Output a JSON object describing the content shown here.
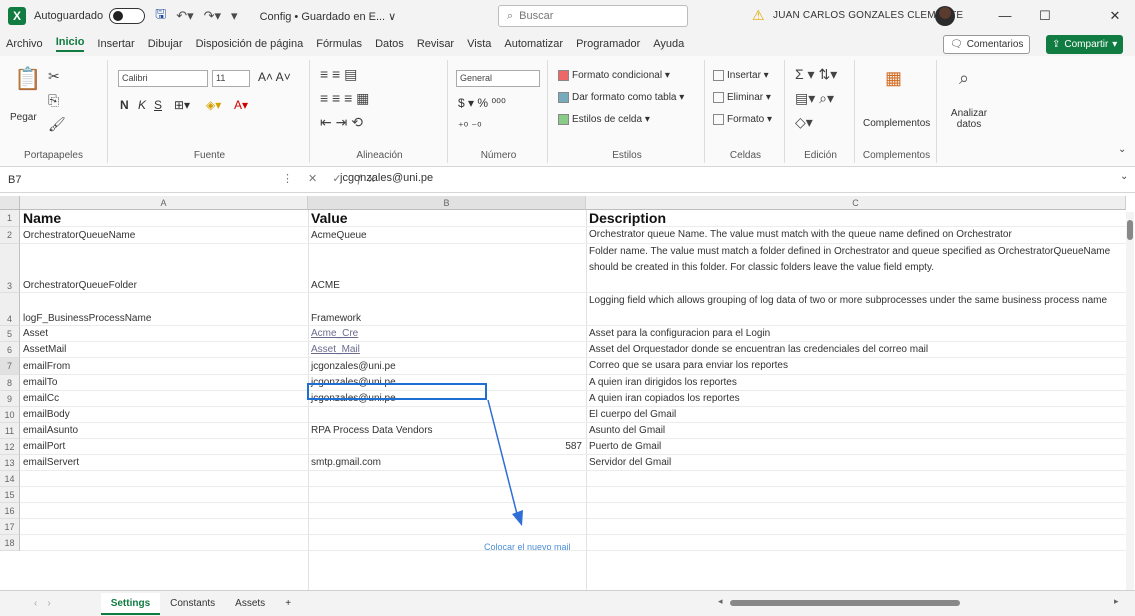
{
  "titlebar": {
    "autosave_label": "Autoguardado",
    "autosave_state": "●",
    "doc_title": "Config • Guardado en E... ∨",
    "search_placeholder": "Buscar",
    "user_name": "JUAN CARLOS GONZALES CLEMENTE"
  },
  "menu": {
    "items": [
      "Archivo",
      "Inicio",
      "Insertar",
      "Dibujar",
      "Disposición de página",
      "Fórmulas",
      "Datos",
      "Revisar",
      "Vista",
      "Automatizar",
      "Programador",
      "Ayuda"
    ],
    "comments_label": "Comentarios",
    "share_label": "Compartir"
  },
  "ribbon": {
    "paste_label": "Pegar",
    "clipboard_label": "Portapapeles",
    "font_name": "Calibri",
    "font_size": "11",
    "font_label": "Fuente",
    "alignment_label": "Alineación",
    "number_format": "General",
    "number_label": "Número",
    "cond_format": "Formato condicional",
    "format_table": "Dar formato como tabla",
    "cell_styles": "Estilos de celda",
    "styles_label": "Estilos",
    "insert": "Insertar",
    "delete": "Eliminar",
    "format": "Formato",
    "cells_label": "Celdas",
    "edit_label": "Edición",
    "complements": "Complementos",
    "complements_label": "Complementos",
    "analyze": "Analizar datos"
  },
  "formula_bar": {
    "cell_ref": "B7",
    "value": "jcgonzales@uni.pe"
  },
  "columns": [
    "A",
    "B",
    "C"
  ],
  "rows": [
    {
      "num": "1",
      "name": "Name",
      "value": "Value",
      "desc": "Description"
    },
    {
      "num": "2",
      "name": "OrchestratorQueueName",
      "value": "AcmeQueue",
      "desc": "Orchestrator queue Name. The value must match with the queue name defined on Orchestrator"
    },
    {
      "num": "3",
      "name": "OrchestratorQueueFolder",
      "value": "ACME",
      "desc": "Folder name. The value must match a folder defined in Orchestrator and queue specified as OrchestratorQueueName should be created in this folder. For classic folders leave the value field empty."
    },
    {
      "num": "4",
      "name": "logF_BusinessProcessName",
      "value": "Framework",
      "desc": "Logging field which allows grouping of log data of two or more subprocesses under the same business process name"
    },
    {
      "num": "5",
      "name": "Asset",
      "value": "Acme_Cre",
      "desc": "Asset para la configuracion para el Login"
    },
    {
      "num": "6",
      "name": "AssetMail",
      "value": "Asset_Mail",
      "desc": "Asset del Orquestador  donde se encuentran las credenciales del correo mail"
    },
    {
      "num": "7",
      "name": "emailFrom",
      "value": "jcgonzales@uni.pe",
      "desc": "Correo que se usara para enviar los reportes"
    },
    {
      "num": "8",
      "name": "emailTo",
      "value": "jcgonzales@uni.pe",
      "desc": "A quien iran dirigidos los reportes"
    },
    {
      "num": "9",
      "name": "emailCc",
      "value": "jcgonzales@uni.pe",
      "desc": "A quien iran copiados los reportes"
    },
    {
      "num": "10",
      "name": "emailBody",
      "value": "",
      "desc": "El cuerpo del Gmail"
    },
    {
      "num": "11",
      "name": "emailAsunto",
      "value": "RPA Process Data Vendors",
      "desc": "Asunto del Gmail"
    },
    {
      "num": "12",
      "name": "emailPort",
      "value": "587",
      "desc": "Puerto de Gmail"
    },
    {
      "num": "13",
      "name": "emailServert",
      "value": "smtp.gmail.com",
      "desc": "Servidor del Gmail"
    },
    {
      "num": "14",
      "name": "",
      "value": "",
      "desc": ""
    },
    {
      "num": "15",
      "name": "",
      "value": "",
      "desc": ""
    },
    {
      "num": "16",
      "name": "",
      "value": "",
      "desc": ""
    },
    {
      "num": "17",
      "name": "",
      "value": "",
      "desc": ""
    },
    {
      "num": "18",
      "name": "",
      "value": "",
      "desc": ""
    }
  ],
  "annotation": "Colocar el nuevo mail",
  "sheets": [
    "Settings",
    "Constants",
    "Assets"
  ],
  "add_sheet": "+",
  "colors": {
    "accent": "#107c41",
    "selection": "#1e6fd1",
    "annotation": "#4c8fd8"
  }
}
